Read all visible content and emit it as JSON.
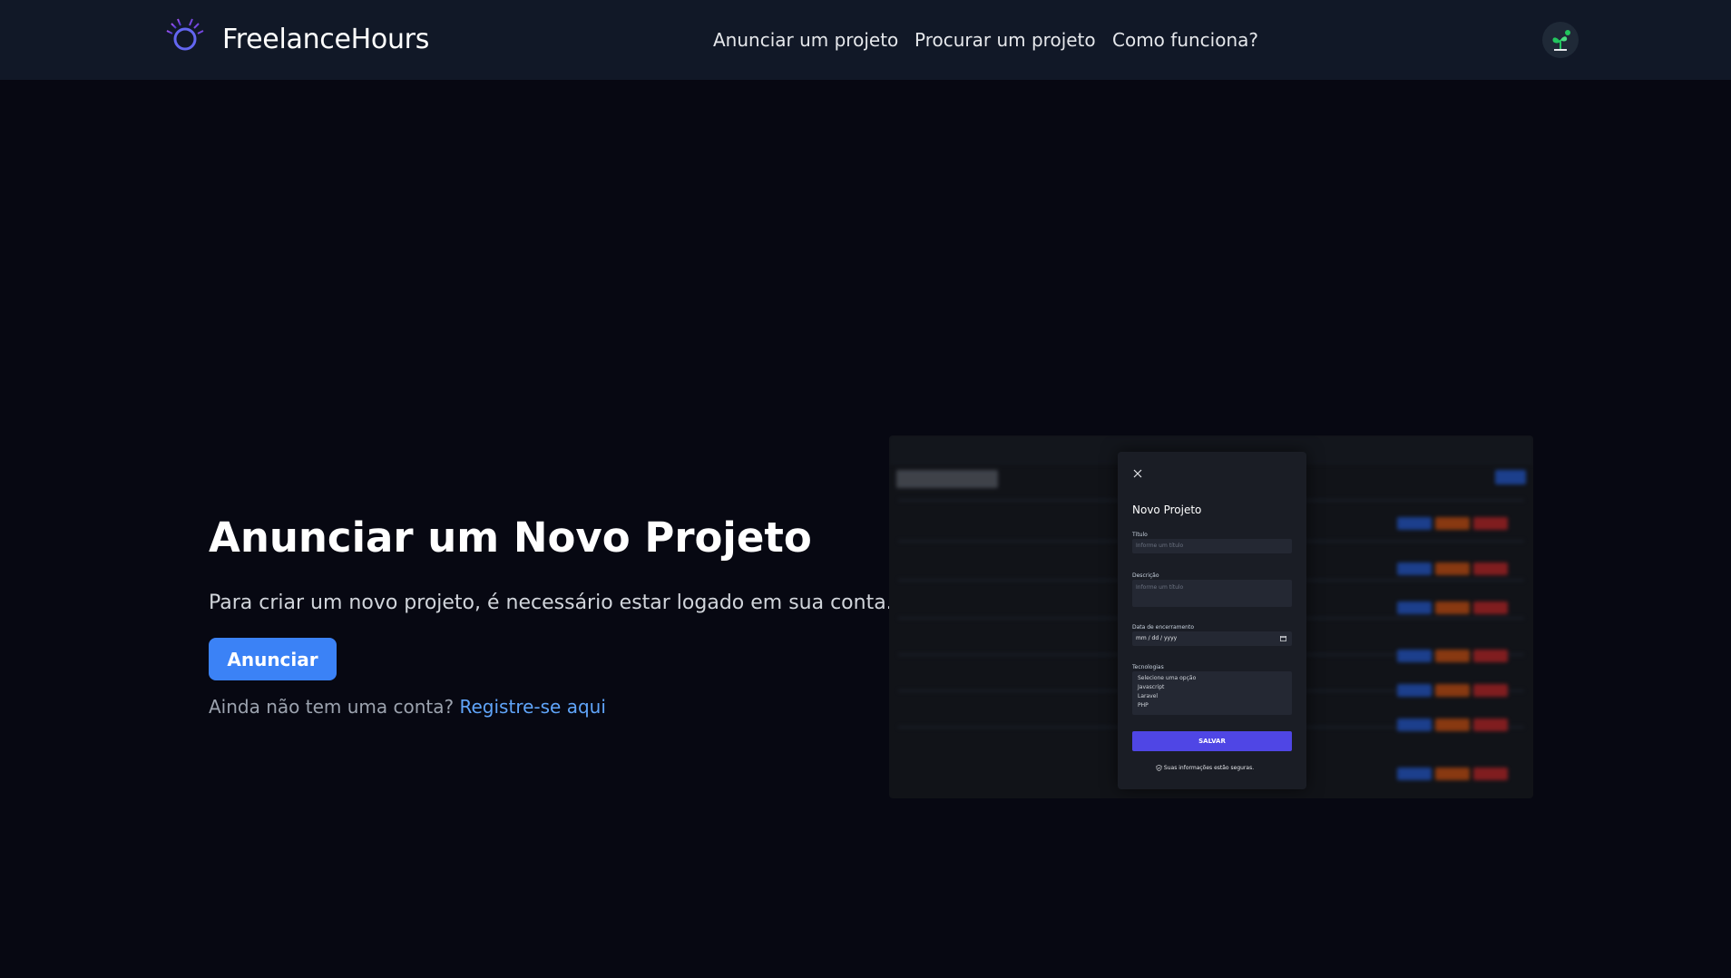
{
  "brand": {
    "name": "FreelanceHours",
    "logo_icon": "spiral-logo-icon"
  },
  "nav": {
    "items": [
      "Anunciar um projeto",
      "Procurar um projeto",
      "Como funciona?"
    ]
  },
  "user": {
    "avatar_icon": "plant-avatar-icon"
  },
  "hero": {
    "title": "Anunciar um Novo Projeto",
    "subtitle": "Para criar um novo projeto, é necessário estar logado em sua conta.",
    "cta_label": "Anunciar",
    "signup_prompt": "Ainda não tem uma conta?",
    "signup_link": "Registre-se aqui"
  },
  "preview": {
    "modal_title": "Novo Projeto",
    "title_label": "Título",
    "title_placeholder": "Informe um título",
    "description_label": "Descrição",
    "description_placeholder": "Informe um título",
    "date_label": "Data de encerramento",
    "date_placeholder": "mm / dd / yyyy",
    "tech_label": "Tecnologias",
    "tech_options": [
      "Selecione uma opção",
      "Javascript",
      "Laravel",
      "PHP"
    ],
    "save_label": "SALVAR",
    "secure_note": "Suas informações estão seguras."
  },
  "colors": {
    "background": "#070812",
    "header": "#111827",
    "primary": "#3b82f6",
    "link": "#60a5fa",
    "save_button": "#4f46e5"
  }
}
